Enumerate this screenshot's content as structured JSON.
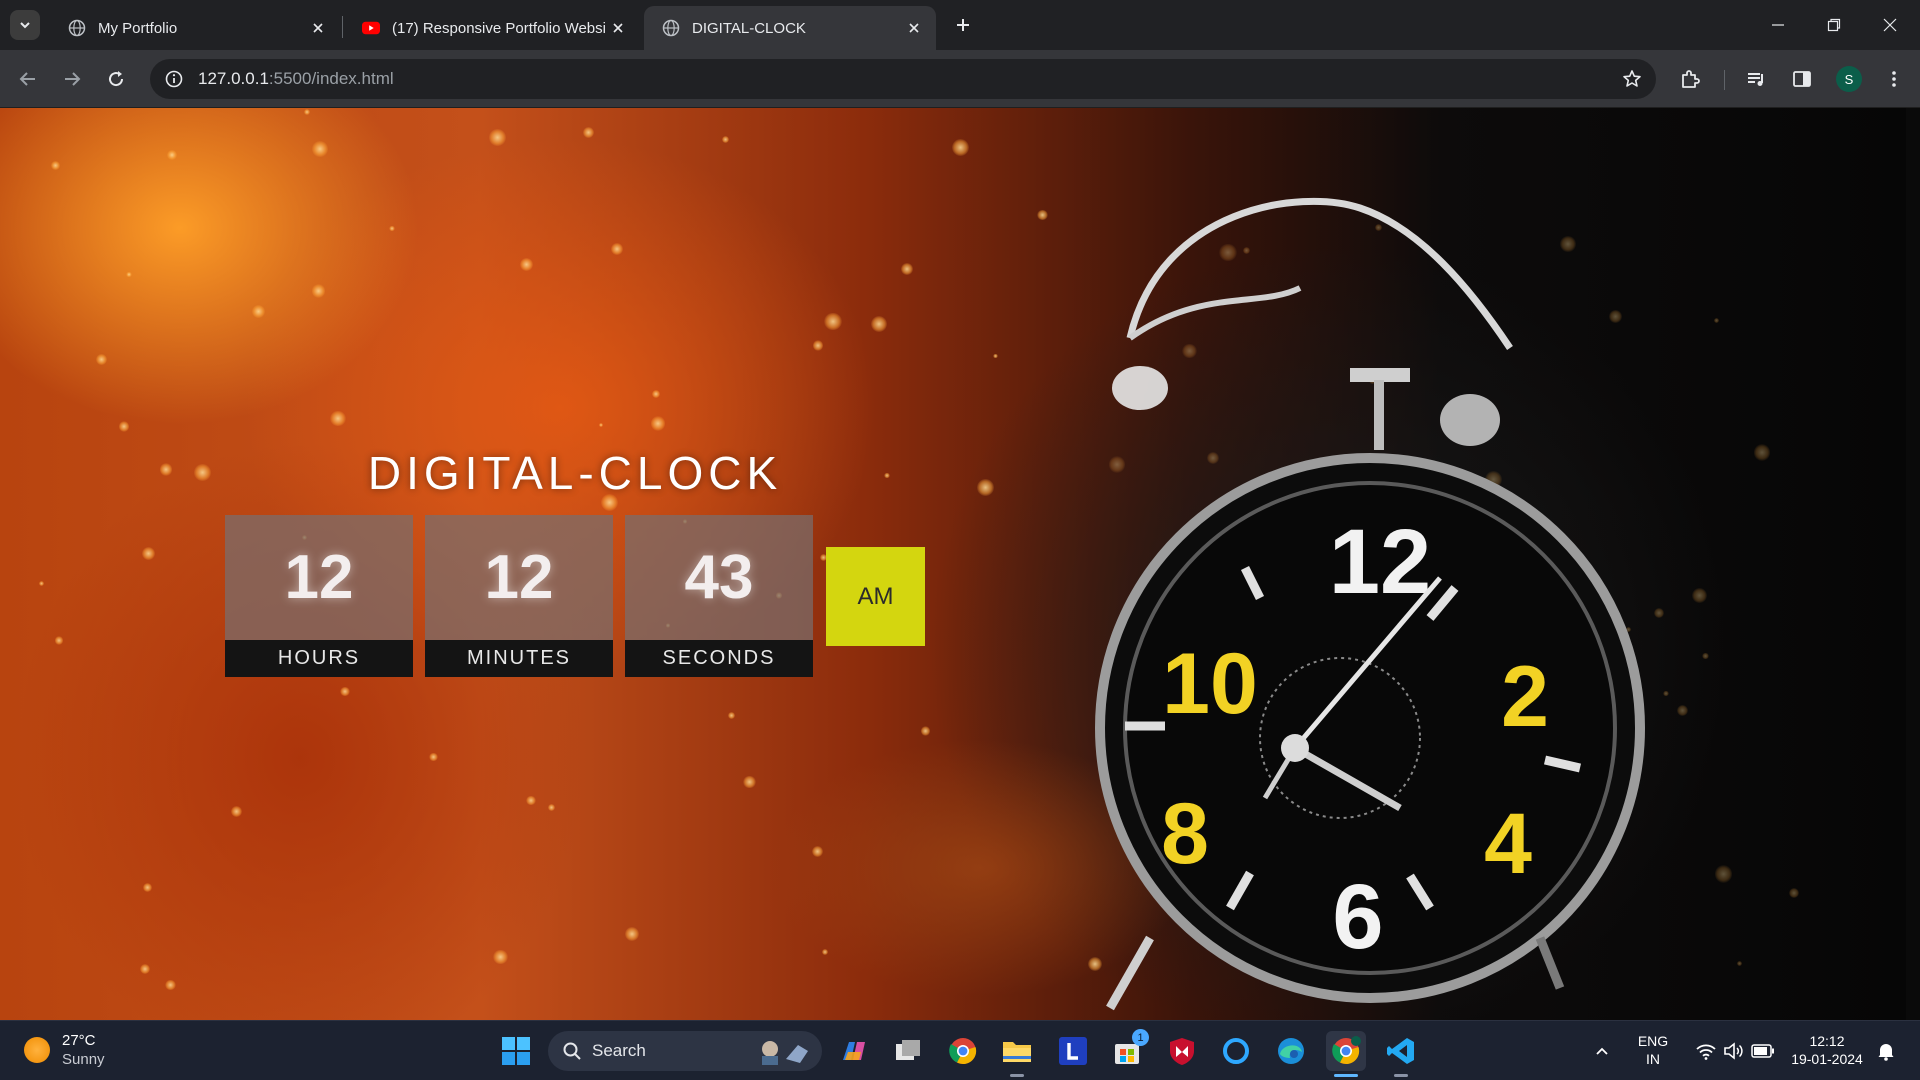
{
  "browser": {
    "tabs": [
      {
        "title": "My Portfolio",
        "favicon": "globe-icon",
        "active": false
      },
      {
        "title": "(17) Responsive Portfolio Websi",
        "favicon": "youtube-icon",
        "active": false
      },
      {
        "title": "DIGITAL-CLOCK",
        "favicon": "globe-icon",
        "active": true
      }
    ],
    "address": {
      "host": "127.0.0.1",
      "rest": ":5500/index.html"
    },
    "profile_initial": "S"
  },
  "clock": {
    "title": "DIGITAL-CLOCK",
    "hours": {
      "value": "12",
      "label": "HOURS"
    },
    "minutes": {
      "value": "12",
      "label": "MINUTES"
    },
    "seconds": {
      "value": "43",
      "label": "SECONDS"
    },
    "period": "AM",
    "art_numbers": {
      "n12": "12",
      "n10": "10",
      "n2": "2",
      "n8": "8",
      "n4": "4",
      "n6": "6"
    }
  },
  "taskbar": {
    "weather": {
      "temp": "27°C",
      "condition": "Sunny"
    },
    "search_label": "Search",
    "store_badge": "1",
    "lang": {
      "line1": "ENG",
      "line2": "IN"
    },
    "clock": {
      "time": "12:12",
      "date": "19-01-2024"
    }
  },
  "colors": {
    "accent_ampm": "#d4d60f",
    "tab_active": "#35363a",
    "taskbar": "#1c2230"
  }
}
